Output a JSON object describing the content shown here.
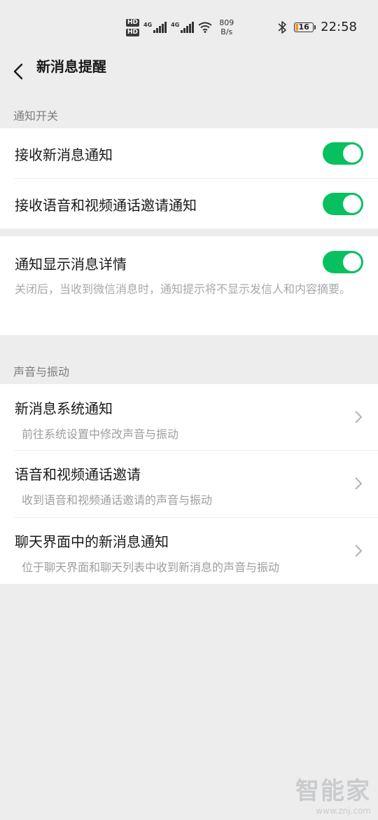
{
  "status_bar": {
    "hd1": "HD",
    "hd2": "HD",
    "net1": "4G",
    "net2": "4G",
    "speed_value": "809",
    "speed_unit": "B/s",
    "battery": "16",
    "battery_level": 0.16,
    "time": "22:58"
  },
  "nav": {
    "title": "新消息提醒"
  },
  "section_notify": {
    "header": "通知开关"
  },
  "notify_items": [
    {
      "label": "接收新消息通知",
      "enabled": true
    },
    {
      "label": "接收语音和视频通话邀请通知",
      "enabled": true
    }
  ],
  "detail_item": {
    "label": "通知显示消息详情",
    "enabled": true,
    "description": "关闭后，当收到微信消息时，通知提示将不显示发信人和内容摘要。"
  },
  "section_sound": {
    "header": "声音与振动"
  },
  "sound_items": [
    {
      "label": "新消息系统通知",
      "sub": "前往系统设置中修改声音与振动"
    },
    {
      "label": "语音和视频通话邀请",
      "sub": "收到语音和视频通话邀请的声音与振动"
    },
    {
      "label": "聊天界面中的新消息通知",
      "sub": "位于聊天界面和聊天列表中收到新消息的声音与振动"
    }
  ],
  "watermark": {
    "logo": "智能家",
    "url": "www.znj.com"
  },
  "colors": {
    "accent": "#07c160",
    "background": "#ededed"
  }
}
